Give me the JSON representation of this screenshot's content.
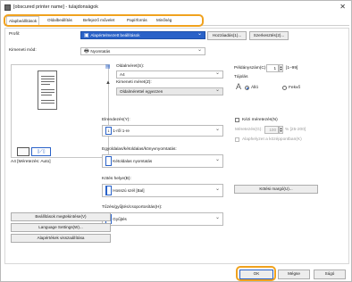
{
  "window": {
    "title": "[obscured printer name] - tulajdonságok",
    "close_glyph": "✕"
  },
  "tabs": [
    {
      "label": "Alapbeállítások",
      "active": true
    },
    {
      "label": "Oldalbeállítás",
      "active": false
    },
    {
      "label": "Befejező művelet",
      "active": false
    },
    {
      "label": "Papírforrás",
      "active": false
    },
    {
      "label": "Minőség",
      "active": false
    }
  ],
  "profile": {
    "label": "Profil:",
    "value": "Alapértelmezett beállítások",
    "add_button": "Hozzáadás(1)...",
    "edit_button": "Szerkesztés(2)..."
  },
  "output_method": {
    "label": "Kimeneti mód:",
    "value": "Nyomtatás"
  },
  "page_size": {
    "label": "Oldalméret(S):",
    "value": "A4"
  },
  "output_size": {
    "label": "Kimeneti méret(Z):",
    "value": "Oldalmérettel egyezzen"
  },
  "copies": {
    "label": "Példányszám(C):",
    "value": "1",
    "range": "[1–99]"
  },
  "orientation": {
    "label": "Tájolás",
    "options": [
      {
        "label": "Álló",
        "selected": true
      },
      {
        "label": "Fekvő",
        "selected": false
      }
    ]
  },
  "preview": {
    "caption": "A4 [Méretezés: Auto]"
  },
  "layout": {
    "label": "Elrendezés(Y):",
    "value": "1-ről 1-re"
  },
  "manual_scaling": {
    "label": "Kézi méretezés(N)",
    "checked": false
  },
  "scaling": {
    "label": "Méretezés(G):",
    "value": "100",
    "range": "% [25-200]"
  },
  "watermark": {
    "label": "Alaphelyzet a középpontban(K)",
    "checked": false
  },
  "duplex": {
    "label": "Egyoldalas/kétoldalas/könyvnyomtatás:",
    "value": "Kétoldalas nyomtatás"
  },
  "binding": {
    "label": "Kötés helye(B):",
    "value": "Hosszú szél [Bal]",
    "margin_button": "Kötési margó(U)..."
  },
  "collate": {
    "label": "Tűzés/gyűjtés/csoportosítás(H):",
    "value": "Gyűjtés"
  },
  "sidebar_buttons": {
    "view_settings": "Beállítások megtekintése(V)",
    "language": "Language Settings(W)...",
    "restore": "Alapértékek visszaállítása"
  },
  "footer": {
    "ok": "OK",
    "cancel": "Mégse",
    "help": "Súgó"
  },
  "colors": {
    "accent": "#2a62c8",
    "highlight": "#f0a21e"
  }
}
